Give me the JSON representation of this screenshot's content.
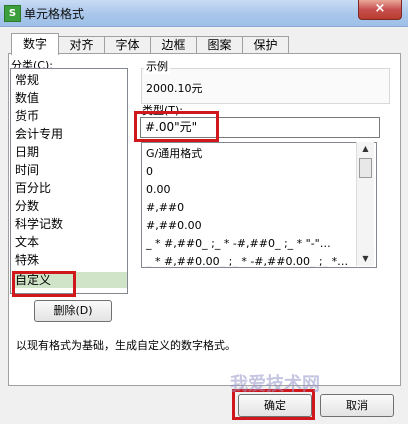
{
  "window": {
    "title": "单元格格式",
    "app_icon": "S",
    "close": "×"
  },
  "tabs": [
    "数字",
    "对齐",
    "字体",
    "边框",
    "图案",
    "保护"
  ],
  "category": {
    "label": "分类(C):",
    "items": [
      "常规",
      "数值",
      "货币",
      "会计专用",
      "日期",
      "时间",
      "百分比",
      "分数",
      "科学记数",
      "文本",
      "特殊",
      "自定义"
    ],
    "selected": "自定义"
  },
  "sample": {
    "label": "示例",
    "value": "2000.10元"
  },
  "type": {
    "label": "类型(T):",
    "value": "#.00\"元\"",
    "formats": [
      "G/通用格式",
      "0",
      "0.00",
      "#,##0",
      "#,##0.00",
      "_ * #,##0_ ;_ * -#,##0_ ;_ * \"-\"…",
      "_ * #,##0.00_ ;_ * -#,##0.00_ ;_ *…"
    ]
  },
  "delete_button": "删除(D)",
  "description": "以现有格式为基础，生成自定义的数字格式。",
  "ok_button": "确定",
  "cancel_button": "取消",
  "watermark": "我爱技术网"
}
